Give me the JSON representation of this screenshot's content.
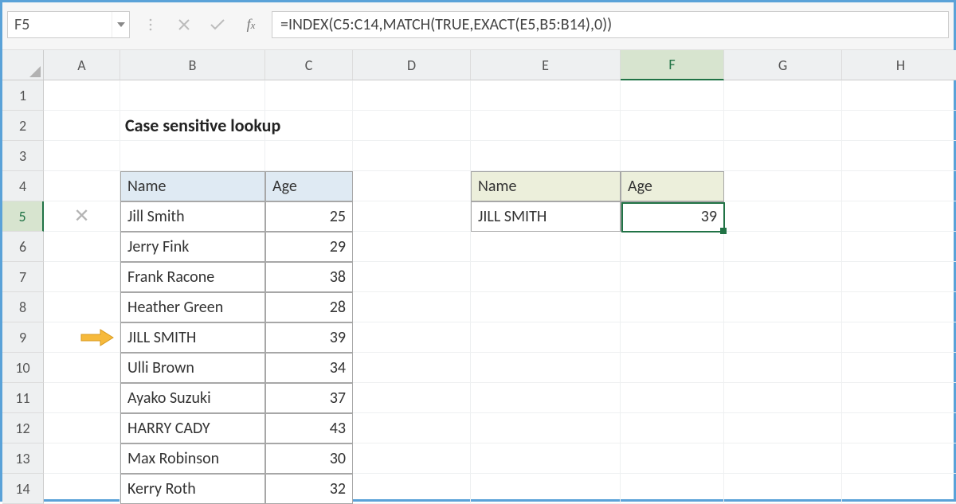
{
  "namebox": {
    "value": "F5"
  },
  "formula_bar": {
    "value": "=INDEX(C5:C14,MATCH(TRUE,EXACT(E5,B5:B14),0))"
  },
  "columns": [
    "A",
    "B",
    "C",
    "D",
    "E",
    "F",
    "G",
    "H"
  ],
  "rows": [
    "1",
    "2",
    "3",
    "4",
    "5",
    "6",
    "7",
    "8",
    "9",
    "10",
    "11",
    "12",
    "13",
    "14"
  ],
  "selected_column_index": 5,
  "selected_row_index": 4,
  "title": "Case sensitive lookup",
  "table1": {
    "headers": {
      "name": "Name",
      "age": "Age"
    },
    "rows": [
      {
        "name": "Jill Smith",
        "age": "25",
        "mark": "x"
      },
      {
        "name": "Jerry Fink",
        "age": "29"
      },
      {
        "name": "Frank Racone",
        "age": "38"
      },
      {
        "name": "Heather Green",
        "age": "28"
      },
      {
        "name": "JILL SMITH",
        "age": "39",
        "mark": "arrow"
      },
      {
        "name": "Ulli Brown",
        "age": "34"
      },
      {
        "name": "Ayako Suzuki",
        "age": "37"
      },
      {
        "name": "HARRY CADY",
        "age": "43"
      },
      {
        "name": "Max Robinson",
        "age": "30"
      },
      {
        "name": "Kerry Roth",
        "age": "32"
      }
    ]
  },
  "table2": {
    "headers": {
      "name": "Name",
      "age": "Age"
    },
    "row": {
      "name": "JILL SMITH",
      "age": "39"
    }
  }
}
